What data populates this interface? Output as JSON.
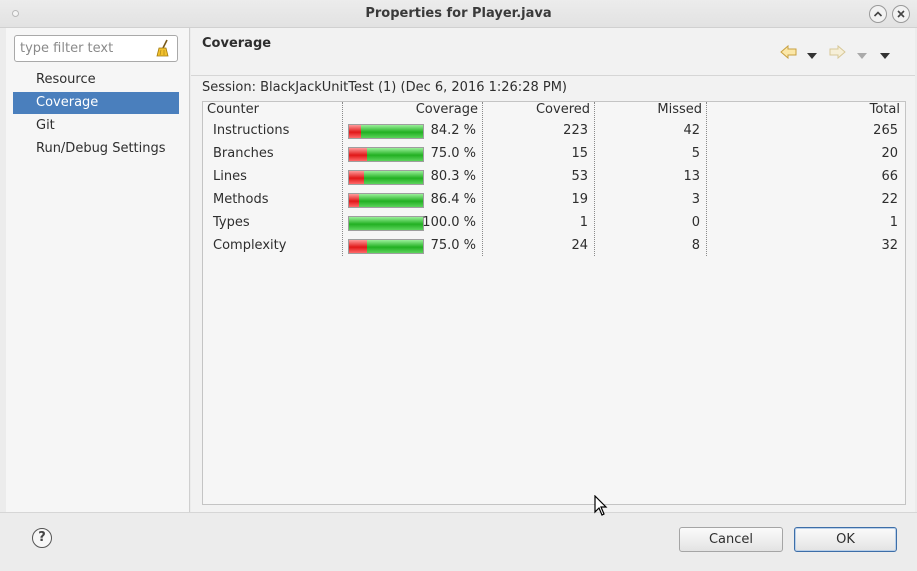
{
  "window": {
    "title": "Properties for Player.java"
  },
  "filter": {
    "placeholder": "type filter text"
  },
  "nav": {
    "items": [
      {
        "label": "Resource"
      },
      {
        "label": "Coverage"
      },
      {
        "label": "Git"
      },
      {
        "label": "Run/Debug Settings"
      }
    ],
    "selected": "Coverage"
  },
  "page": {
    "title": "Coverage",
    "session": "Session: BlackJackUnitTest (1) (Dec 6, 2016 1:26:28 PM)"
  },
  "table": {
    "headers": {
      "counter": "Counter",
      "coverage": "Coverage",
      "covered": "Covered",
      "missed": "Missed",
      "total": "Total"
    },
    "rows": [
      {
        "counter": "Instructions",
        "coverage": "84.2 %",
        "covered": "223",
        "missed": "42",
        "total": "265",
        "fraction": 0.842
      },
      {
        "counter": "Branches",
        "coverage": "75.0 %",
        "covered": "15",
        "missed": "5",
        "total": "20",
        "fraction": 0.75
      },
      {
        "counter": "Lines",
        "coverage": "80.3 %",
        "covered": "53",
        "missed": "13",
        "total": "66",
        "fraction": 0.803
      },
      {
        "counter": "Methods",
        "coverage": "86.4 %",
        "covered": "19",
        "missed": "3",
        "total": "22",
        "fraction": 0.864
      },
      {
        "counter": "Types",
        "coverage": "100.0 %",
        "covered": "1",
        "missed": "0",
        "total": "1",
        "fraction": 1.0
      },
      {
        "counter": "Complexity",
        "coverage": "75.0 %",
        "covered": "24",
        "missed": "8",
        "total": "32",
        "fraction": 0.75
      }
    ]
  },
  "buttons": {
    "cancel": "Cancel",
    "ok": "OK",
    "help": "?"
  },
  "icons": {
    "back": "arrow-left-icon",
    "forward": "arrow-right-icon",
    "menu": "chevron-down-icon",
    "clear_filter": "broom-icon",
    "help": "help-icon"
  },
  "colors": {
    "selection": "#4a7fbd",
    "covered": "#22b022",
    "missed": "#e01818"
  }
}
